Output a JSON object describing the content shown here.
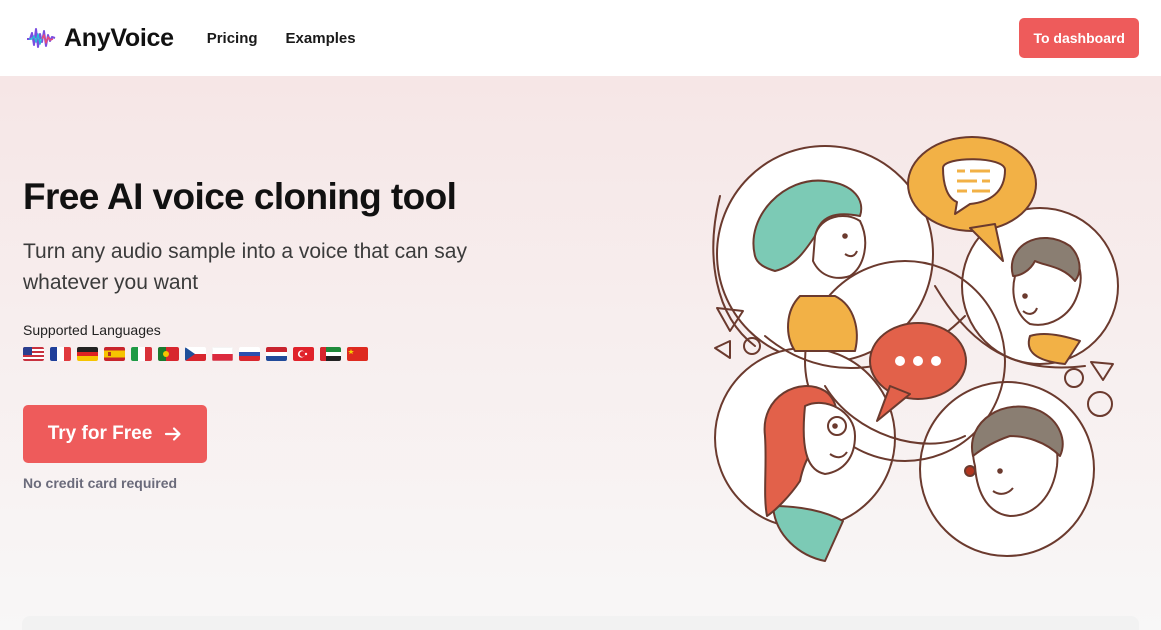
{
  "header": {
    "logo_text": "AnyVoice",
    "nav": [
      "Pricing",
      "Examples"
    ],
    "dashboard_label": "To dashboard"
  },
  "hero": {
    "title": "Free AI voice cloning tool",
    "subtitle": "Turn any audio sample into a voice that can say whatever you want",
    "languages_label": "Supported Languages",
    "cta_label": "Try for Free",
    "cta_icon": "arrow-right-icon",
    "note": "No credit card required"
  },
  "flags": [
    "us",
    "fr",
    "de",
    "es",
    "it",
    "pt",
    "cz",
    "pl",
    "ru",
    "nl",
    "tr",
    "ae",
    "cn"
  ],
  "colors": {
    "accent": "#ee5b5b",
    "teal": "#7ccab5",
    "orange": "#f2b146",
    "line": "#6b3a2e"
  }
}
